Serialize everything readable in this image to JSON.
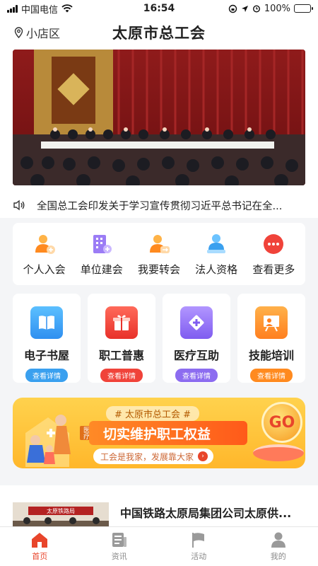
{
  "status_bar": {
    "carrier": "中国电信",
    "time": "16:54",
    "battery": "100%"
  },
  "header": {
    "location": "小店区",
    "title": "太原市总工会"
  },
  "notice": {
    "text": "全国总工会印发关于学习宣传贯彻习近平总书记在全..."
  },
  "quick_actions": [
    {
      "label": "个人入会",
      "icon": "person-add-icon",
      "color": "#ff8a1f"
    },
    {
      "label": "单位建会",
      "icon": "building-icon",
      "color": "#8c6cf0"
    },
    {
      "label": "我要转会",
      "icon": "person-transfer-icon",
      "color": "#ff8a1f"
    },
    {
      "label": "法人资格",
      "icon": "legal-person-icon",
      "color": "#3aa0ef"
    },
    {
      "label": "查看更多",
      "icon": "more-icon",
      "color": "#f0433a"
    }
  ],
  "feature_cards": [
    {
      "title": "电子书屋",
      "button": "查看详情",
      "color": "#3aa0ef",
      "icon": "book-icon"
    },
    {
      "title": "职工普惠",
      "button": "查看详情",
      "color": "#f0433a",
      "icon": "gift-icon"
    },
    {
      "title": "医疗互助",
      "button": "查看详情",
      "color": "#8c6cf0",
      "icon": "medical-icon"
    },
    {
      "title": "技能培训",
      "button": "查看详情",
      "color": "#ff8a1f",
      "icon": "training-icon"
    }
  ],
  "promo": {
    "tag": "# 太原市总工会 #",
    "side_label": "医疗",
    "title": "切实维护职工权益",
    "subtitle": "工会是我家，发展靠大家",
    "go": "GO"
  },
  "news": {
    "title": "中国铁路太原局集团公司太原供...",
    "thumb_caption": "太原铁路局"
  },
  "tabbar": [
    {
      "label": "首页",
      "icon": "home-icon",
      "active": true
    },
    {
      "label": "资讯",
      "icon": "news-icon",
      "active": false
    },
    {
      "label": "活动",
      "icon": "flag-icon",
      "active": false
    },
    {
      "label": "我的",
      "icon": "profile-icon",
      "active": false
    }
  ]
}
